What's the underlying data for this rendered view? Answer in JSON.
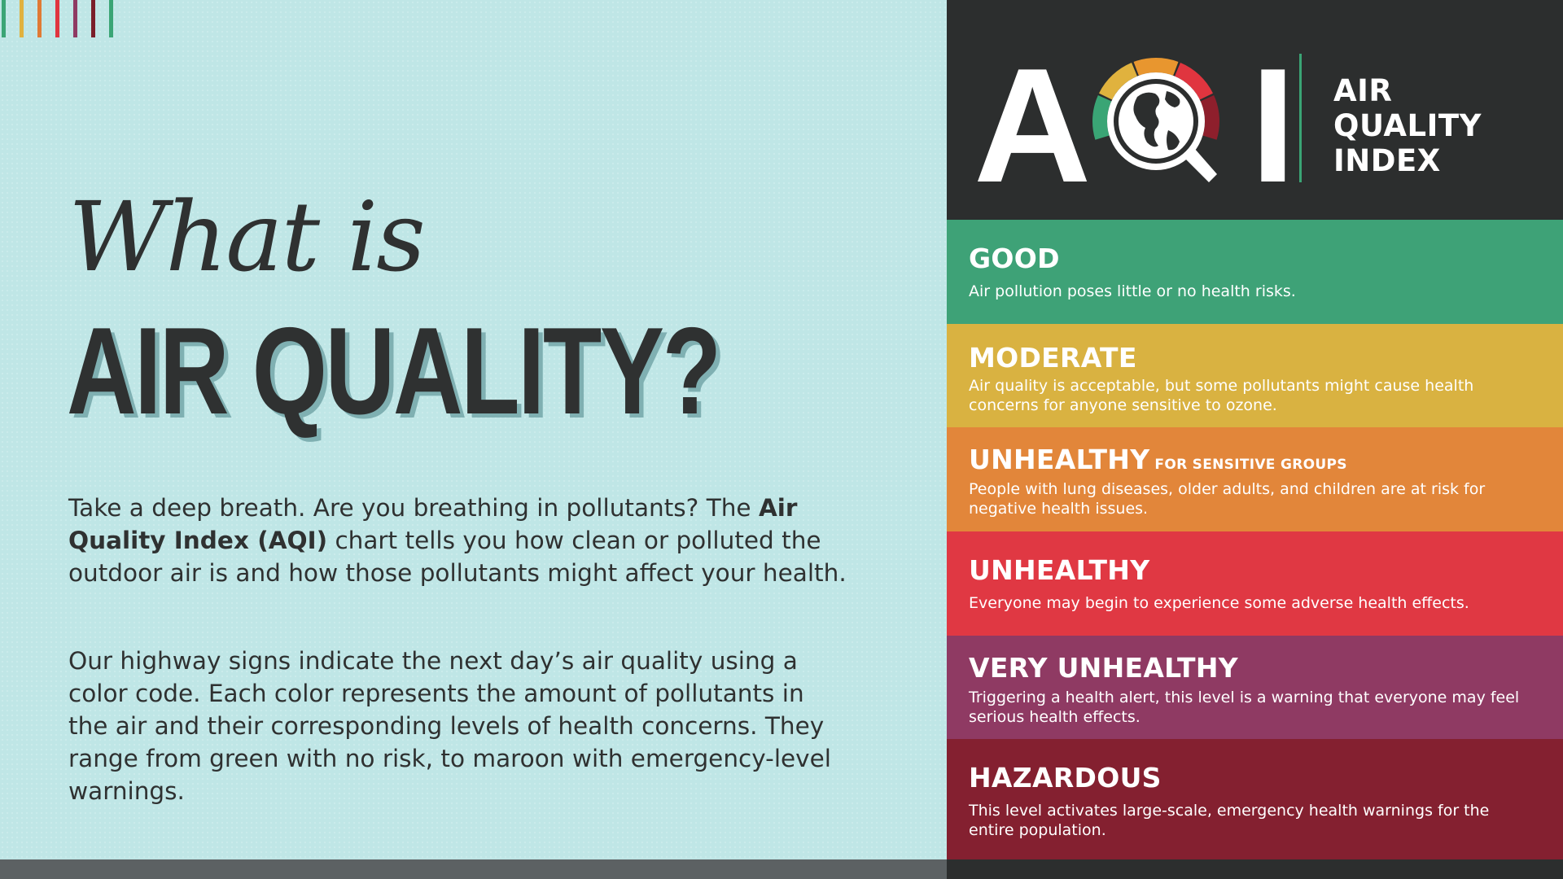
{
  "stripes": [
    "#3aa575",
    "#e0b23e",
    "#e07a34",
    "#e0353f",
    "#8f3a63",
    "#7a1f2a",
    "#3aa575"
  ],
  "heading": {
    "script": "What is",
    "main": "AIR QUALITY?"
  },
  "intro": {
    "p1_start": "Take a deep breath. Are you breathing in pollutants? The ",
    "p1_bold": "Air Quality Index (AQI)",
    "p1_end": " chart tells you how clean or polluted the outdoor air is and how those pollutants might affect your health.",
    "p2": "Our highway signs indicate the next day’s air quality using a color code. Each color represents the amount of pollutants in the air and their corresponding levels of health concerns. They range from green with no risk, to maroon with emergency-level warnings."
  },
  "logo": {
    "letter_a": "A",
    "letter_i": "I",
    "sub_line1": "AIR",
    "sub_line2": "QUALITY",
    "sub_line3": "INDEX",
    "gauge_colors": [
      "#3aa575",
      "#e0b23e",
      "#e8962f",
      "#e0353f",
      "#8e1f2c"
    ]
  },
  "levels": [
    {
      "title": "GOOD",
      "title_small": "",
      "desc": "Air pollution poses little or no health risks.",
      "color": "#3ea277"
    },
    {
      "title": "MODERATE",
      "title_small": "",
      "desc": "Air quality is acceptable, but some pollutants might cause health concerns for anyone sensitive to ozone.",
      "color": "#d9b241"
    },
    {
      "title": "UNHEALTHY",
      "title_small": "FOR SENSITIVE GROUPS",
      "desc": "People with lung diseases, older adults, and children are at risk for negative health issues.",
      "color": "#e2863a"
    },
    {
      "title": "UNHEALTHY",
      "title_small": "",
      "desc": "Everyone may begin to experience some adverse health effects.",
      "color": "#e03843"
    },
    {
      "title": "VERY UNHEALTHY",
      "title_small": "",
      "desc": "Triggering a health alert, this level is a warning that everyone may feel serious health effects.",
      "color": "#8f3a63"
    },
    {
      "title": "HAZARDOUS",
      "title_small": "",
      "desc": "This level activates large-scale, emergency health warnings for the entire population.",
      "color": "#842030"
    }
  ]
}
